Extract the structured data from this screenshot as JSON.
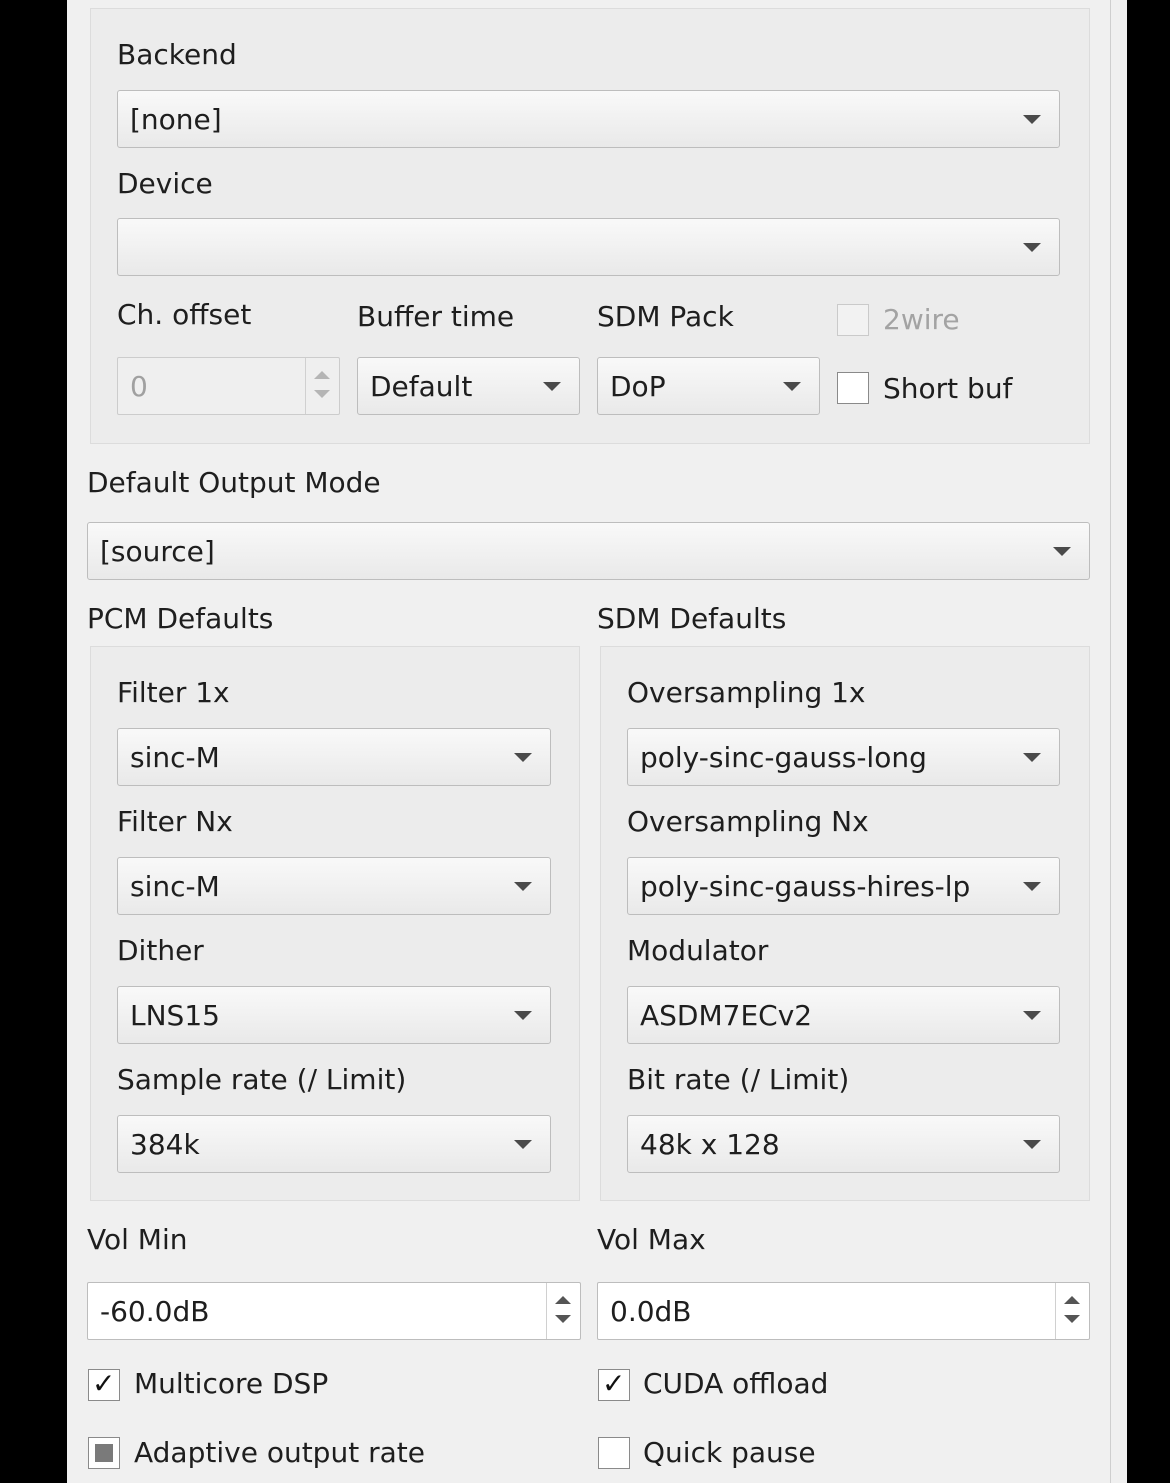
{
  "device_group": {
    "backend_label": "Backend",
    "backend_value": "[none]",
    "device_label": "Device",
    "device_value": "",
    "ch_offset_label": "Ch. offset",
    "ch_offset_value": "0",
    "buffer_time_label": "Buffer time",
    "buffer_time_value": "Default",
    "sdm_pack_label": "SDM Pack",
    "sdm_pack_value": "DoP",
    "two_wire_label": "2wire",
    "two_wire_checked": false,
    "short_buf_label": "Short buf",
    "short_buf_checked": false
  },
  "output_mode": {
    "label": "Default Output Mode",
    "value": "[source]"
  },
  "pcm_defaults": {
    "title": "PCM Defaults",
    "filter_1x_label": "Filter 1x",
    "filter_1x_value": "sinc-M",
    "filter_nx_label": "Filter Nx",
    "filter_nx_value": "sinc-M",
    "dither_label": "Dither",
    "dither_value": "LNS15",
    "sample_rate_label": "Sample rate (/ Limit)",
    "sample_rate_value": "384k"
  },
  "sdm_defaults": {
    "title": "SDM Defaults",
    "oversampling_1x_label": "Oversampling 1x",
    "oversampling_1x_value": "poly-sinc-gauss-long",
    "oversampling_nx_label": "Oversampling Nx",
    "oversampling_nx_value": "poly-sinc-gauss-hires-lp",
    "modulator_label": "Modulator",
    "modulator_value": "ASDM7ECv2",
    "bit_rate_label": "Bit rate (/ Limit)",
    "bit_rate_value": "48k x 128"
  },
  "volume": {
    "min_label": "Vol Min",
    "min_value": "-60.0dB",
    "max_label": "Vol Max",
    "max_value": "0.0dB"
  },
  "options": {
    "multicore_dsp_label": "Multicore DSP",
    "multicore_dsp_checked": true,
    "cuda_offload_label": "CUDA offload",
    "cuda_offload_checked": true,
    "adaptive_output_rate_label": "Adaptive output rate",
    "adaptive_output_rate_state": "partial",
    "quick_pause_label": "Quick pause",
    "quick_pause_checked": false
  },
  "colors": {
    "panel_bg": "#f0f0f0",
    "group_bg": "#ececec",
    "text": "#1e1e1e",
    "disabled_text": "#a3a3a3",
    "outside_bg": "#000000"
  },
  "icons": {
    "dropdown": "chevron-down-icon",
    "spin_up": "arrow-up-icon",
    "spin_down": "arrow-down-icon",
    "check": "checkmark-icon"
  }
}
